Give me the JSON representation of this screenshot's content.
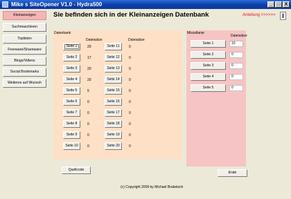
{
  "window": {
    "title": "Mike s SiteOpener V1.0 - Hydra500",
    "buttons": [
      "_",
      "□",
      "X"
    ]
  },
  "nav": {
    "items": [
      {
        "label": "Kleinanzeigen",
        "active": true
      },
      {
        "label": "Suchmaschinen"
      },
      {
        "label": "Toplisten"
      },
      {
        "label": "Freeware/Shareware"
      },
      {
        "label": "Blogs/Videos"
      },
      {
        "label": "Social Bookmarks"
      },
      {
        "label": "Weiteres auf Wunsch"
      }
    ]
  },
  "main": {
    "heading": "Sie befinden sich in der Kleinanzeigen Datenbank",
    "help_link": "Anleitung >>>>>>",
    "help_icon": "I"
  },
  "database": {
    "title": "Datenbank",
    "col_size_label": "Dateisätze",
    "left_column": [
      {
        "label": "Seite 1",
        "size": "20"
      },
      {
        "label": "Seite 2",
        "size": "17"
      },
      {
        "label": "Seite 3",
        "size": "20"
      },
      {
        "label": "Seite 4",
        "size": "20"
      },
      {
        "label": "Seite 5",
        "size": "5"
      },
      {
        "label": "Seite 6",
        "size": "0"
      },
      {
        "label": "Seite 7",
        "size": "0"
      },
      {
        "label": "Seite 8",
        "size": "0"
      },
      {
        "label": "Seite 9",
        "size": "0"
      },
      {
        "label": "Seite 10",
        "size": "0"
      }
    ],
    "right_column": [
      {
        "label": "Seite 11",
        "size": "0"
      },
      {
        "label": "Seite 12",
        "size": "0"
      },
      {
        "label": "Seite 13",
        "size": "0"
      },
      {
        "label": "Seite 14",
        "size": "0"
      },
      {
        "label": "Seite 15",
        "size": "0"
      },
      {
        "label": "Seite 16",
        "size": "0"
      },
      {
        "label": "Seite 17",
        "size": "0"
      },
      {
        "label": "Seite 18",
        "size": "0"
      },
      {
        "label": "Seite 19",
        "size": "0"
      },
      {
        "label": "Seite 20",
        "size": "0"
      }
    ]
  },
  "misc": {
    "title": "Miscellanie",
    "col_size_label": "Dateisätze",
    "items": [
      {
        "label": "Seite 1",
        "size": "10"
      },
      {
        "label": "Seite 2",
        "size": "0"
      },
      {
        "label": "Seite 3",
        "size": "0"
      },
      {
        "label": "Seite 4",
        "size": "0"
      },
      {
        "label": "Seite 5",
        "size": "0"
      }
    ]
  },
  "footer": {
    "source_button": "Quellcode",
    "end_button": "Ende",
    "copyright": "(c) Copyright 2009 by Michael Brabetsch"
  },
  "colors": {
    "title_bar": "#0a3ea8",
    "db_panel": "#fde0c5",
    "misc_panel": "#f6c4c4",
    "active_nav": "#f3b6b6",
    "help_link": "#e01818"
  }
}
